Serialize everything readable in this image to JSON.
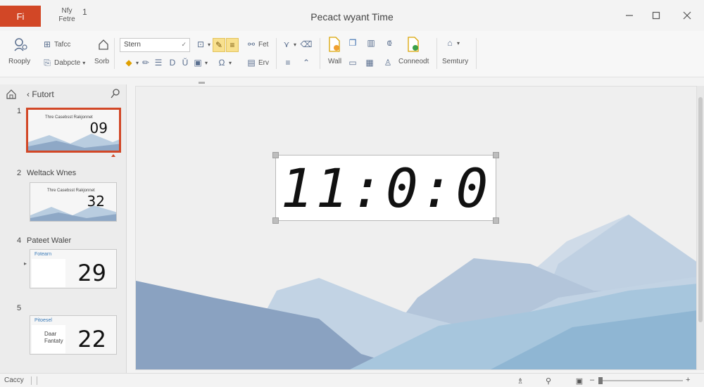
{
  "titlebar": {
    "app_label": "Fi",
    "file_name": "Nfy Fetre",
    "file_num": "1",
    "doc_title": "Pecact wyant Time"
  },
  "ribbon": {
    "reply": "Rooply",
    "table": "Tafcc",
    "dabpete": "Dabpcte",
    "sort": "Sorb",
    "font_value": "Stern",
    "fet": "Fet",
    "erv": "Erv",
    "wall": "Wall",
    "connect": "Conneodt",
    "similarity": "Semtury"
  },
  "thumbnails": {
    "header": "Futort",
    "slides": [
      {
        "num": "1",
        "title": "",
        "text": "Thre Casebsst Rakjonnet",
        "number": "09"
      },
      {
        "num": "2",
        "title": "Weltack Wnes",
        "text": "Thre Casebsst Rakjonnet",
        "number": "32"
      },
      {
        "num": "4",
        "title": "Pateet Waler",
        "label": "Fotearn",
        "number": "29"
      },
      {
        "num": "5",
        "title": "",
        "label": "Pitoesel",
        "text": "Daar Fantaty",
        "number": "22"
      }
    ]
  },
  "slide": {
    "clock": "11:0:0"
  },
  "statusbar": {
    "text": "Caccy"
  },
  "colors": {
    "accent": "#d24726",
    "mountain_dark": "#8ea8c6",
    "mountain_light": "#b9cde0"
  }
}
